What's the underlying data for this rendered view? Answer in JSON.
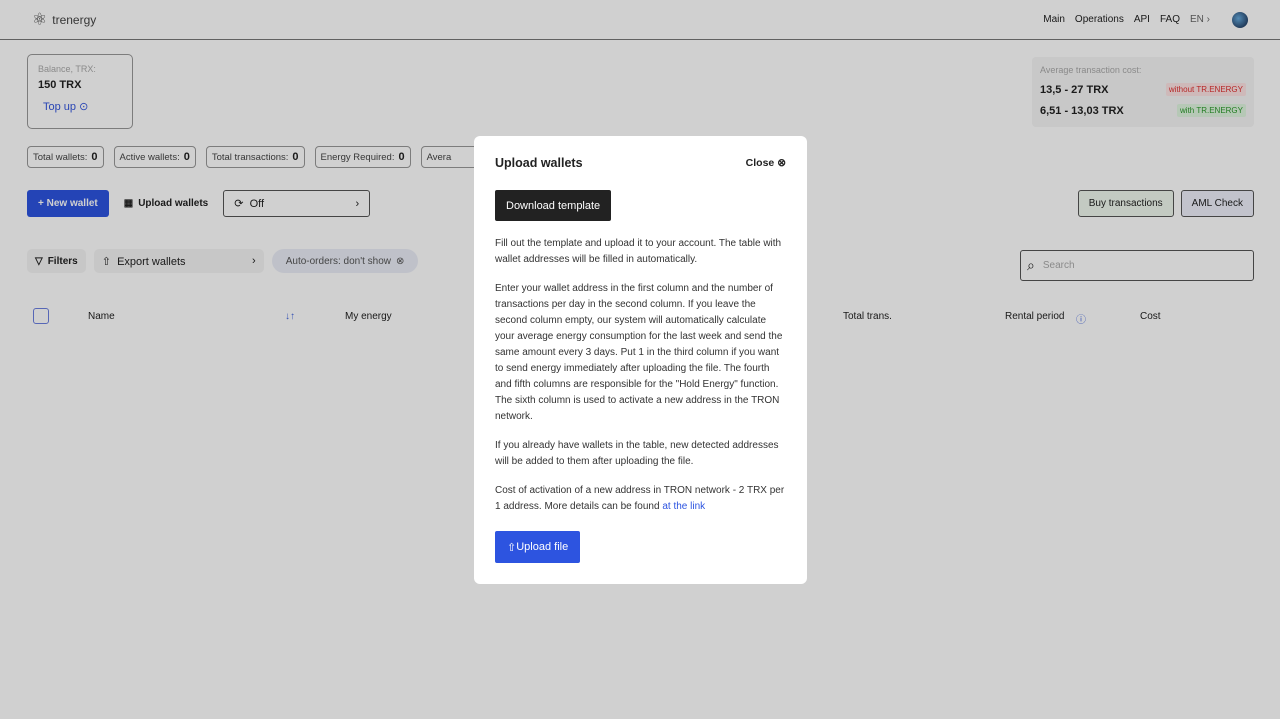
{
  "header": {
    "logo": "trenergy",
    "nav": [
      "Main",
      "Operations",
      "API",
      "FAQ"
    ],
    "lang": "EN"
  },
  "balance": {
    "label": "Balance, TRX:",
    "value": "150 TRX",
    "topup": "Top up"
  },
  "avg": {
    "label": "Average transaction cost:",
    "rows": [
      {
        "value": "13,5 - 27 TRX",
        "tag": "without TR.ENERGY",
        "color": "#e03030"
      },
      {
        "value": "6,51 - 13,03 TRX",
        "tag": "with TR.ENERGY",
        "color": "#2a9a2a"
      }
    ]
  },
  "stats": [
    {
      "label": "Total wallets:",
      "value": "0"
    },
    {
      "label": "Active wallets:",
      "value": "0"
    },
    {
      "label": "Total transactions:",
      "value": "0"
    },
    {
      "label": "Energy Required:",
      "value": "0"
    },
    {
      "label": "Avera",
      "value": ""
    }
  ],
  "toolbar": {
    "new_wallet": "+ New wallet",
    "upload": "Upload wallets",
    "auto": "Off",
    "buy": "Buy transactions",
    "aml": "AML Check"
  },
  "filters": {
    "filters": "Filters",
    "export": "Export wallets",
    "auto_orders": "Auto-orders: don't show",
    "search_placeholder": "Search"
  },
  "table": {
    "columns": [
      "Name",
      "My energy",
      "Total trans.",
      "Rental period",
      "Cost"
    ]
  },
  "modal": {
    "title": "Upload wallets",
    "close": "Close",
    "download": "Download template",
    "p1": "Fill out the template and upload it to your account. The table with wallet addresses will be filled in automatically.",
    "p2": "Enter your wallet address in the first column and the number of transactions per day in the second column. If you leave the second column empty, our system will automatically calculate your average energy consumption for the last week and send the same amount every 3 days. Put 1 in the third column if you want to send energy immediately after uploading the file. The fourth and fifth columns are responsible for the \"Hold Energy\" function. The sixth column is used to activate a new address in the TRON network.",
    "p3": "If you already have wallets in the table, new detected addresses will be added to them after uploading the file.",
    "p4": "Cost of activation of a new address in TRON network - 2 TRX per 1 address. More details can be found ",
    "link": "at the link",
    "upload": "Upload file"
  }
}
